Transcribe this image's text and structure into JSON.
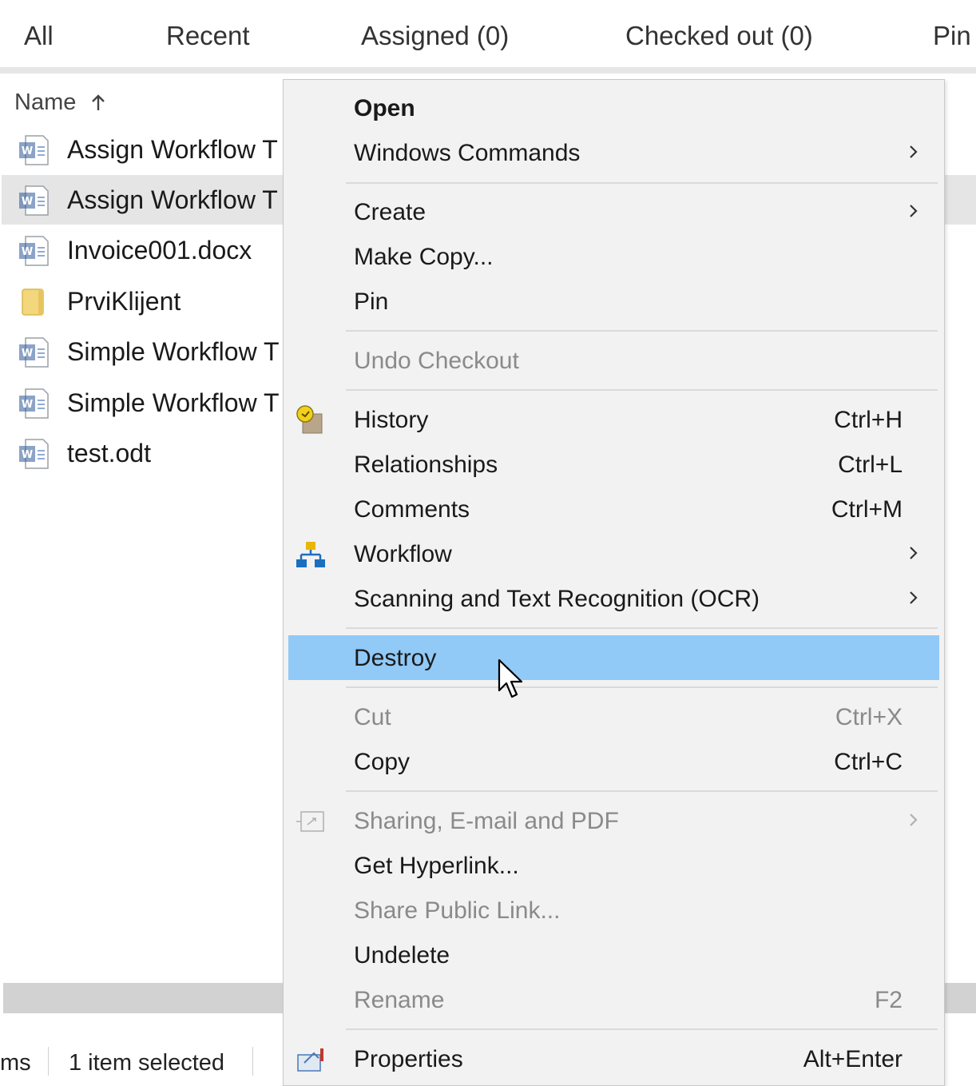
{
  "tabs": [
    "All",
    "Recent",
    "Assigned (0)",
    "Checked out (0)",
    "Pin"
  ],
  "list": {
    "header": "Name",
    "rows": [
      {
        "name": "Assign Workflow T",
        "icon": "word-document-icon"
      },
      {
        "name": "Assign Workflow T",
        "icon": "word-document-icon",
        "selected": true
      },
      {
        "name": "Invoice001.docx",
        "icon": "word-document-icon"
      },
      {
        "name": "PrviKlijent",
        "icon": "folder-icon"
      },
      {
        "name": "Simple Workflow T",
        "icon": "word-document-icon"
      },
      {
        "name": "Simple Workflow T",
        "icon": "word-document-icon"
      },
      {
        "name": "test.odt",
        "icon": "word-document-icon"
      }
    ]
  },
  "status": {
    "items_fragment": "ms",
    "selected": "1 item selected"
  },
  "menu": {
    "open": "Open",
    "windows_commands": "Windows Commands",
    "create": "Create",
    "make_copy": "Make Copy...",
    "pin": "Pin",
    "undo_checkout": "Undo Checkout",
    "history": "History",
    "history_shortcut": "Ctrl+H",
    "relationships": "Relationships",
    "relationships_shortcut": "Ctrl+L",
    "comments": "Comments",
    "comments_shortcut": "Ctrl+M",
    "workflow": "Workflow",
    "ocr": "Scanning and Text Recognition (OCR)",
    "destroy": "Destroy",
    "cut": "Cut",
    "cut_shortcut": "Ctrl+X",
    "copy": "Copy",
    "copy_shortcut": "Ctrl+C",
    "sharing": "Sharing, E-mail and PDF",
    "get_hyperlink": "Get Hyperlink...",
    "share_public_link": "Share Public Link...",
    "undelete": "Undelete",
    "rename": "Rename",
    "rename_shortcut": "F2",
    "properties": "Properties",
    "properties_shortcut": "Alt+Enter"
  },
  "colors": {
    "highlight": "#91c9f7",
    "selected_row": "#e5e5e5",
    "menu_bg": "#f2f2f2",
    "disabled_text": "#8a8a8a"
  }
}
